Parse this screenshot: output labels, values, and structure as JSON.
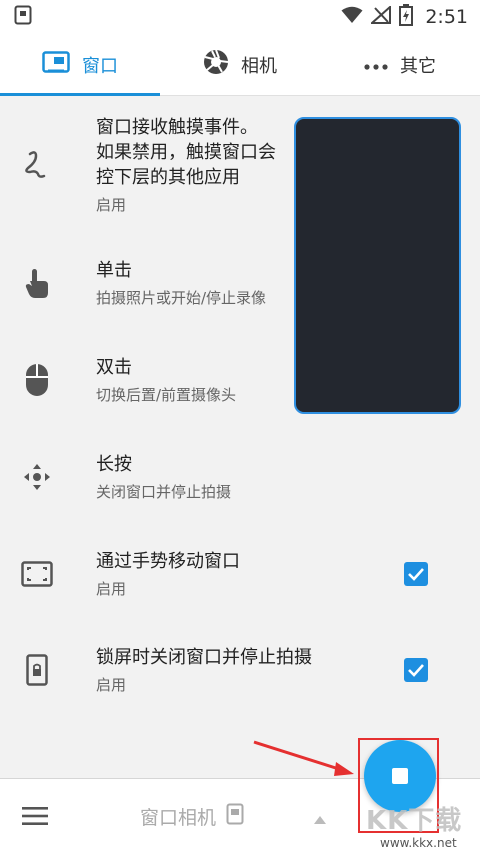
{
  "status_bar": {
    "time": "2:51",
    "icons": [
      "app-notification-icon",
      "wifi-icon",
      "signal-icon",
      "battery-icon"
    ]
  },
  "tabs": [
    {
      "label": "窗口",
      "icon": "window-icon",
      "active": true
    },
    {
      "label": "相机",
      "icon": "camera-aperture-icon",
      "active": false
    },
    {
      "label": "其它",
      "icon": "more-dots-icon",
      "active": false
    }
  ],
  "settings": [
    {
      "title": "窗口接收触摸事件。\n如果禁用，触摸窗口会\n控下层的其他应用",
      "subtitle": "启用",
      "icon": "touch-gesture-icon"
    },
    {
      "title": "单击",
      "subtitle": "拍摄照片或开始/停止录像",
      "icon": "tap-icon"
    },
    {
      "title": "双击",
      "subtitle": "切换后置/前置摄像头",
      "icon": "mouse-icon"
    },
    {
      "title": "长按",
      "subtitle": "关闭窗口并停止拍摄",
      "icon": "move-icon"
    },
    {
      "title": "通过手势移动窗口",
      "subtitle": "启用",
      "icon": "fullscreen-icon",
      "checked": true
    },
    {
      "title": "锁屏时关闭窗口并停止拍摄",
      "subtitle": "启用",
      "icon": "lock-phone-icon",
      "checked": true
    }
  ],
  "bottom_bar": {
    "label": "窗口相机",
    "menu_icon": "menu-icon",
    "label_icon": "phone-window-icon",
    "up_icon": "triangle-up-icon"
  },
  "fab": {
    "icon": "stop-icon"
  },
  "watermark": {
    "text": "KK下载",
    "url": "www.kkx.net"
  },
  "colors": {
    "accent": "#1a8fd8",
    "fab": "#1ea5ef",
    "highlight": "#e53030",
    "preview_bg": "#23272f"
  }
}
